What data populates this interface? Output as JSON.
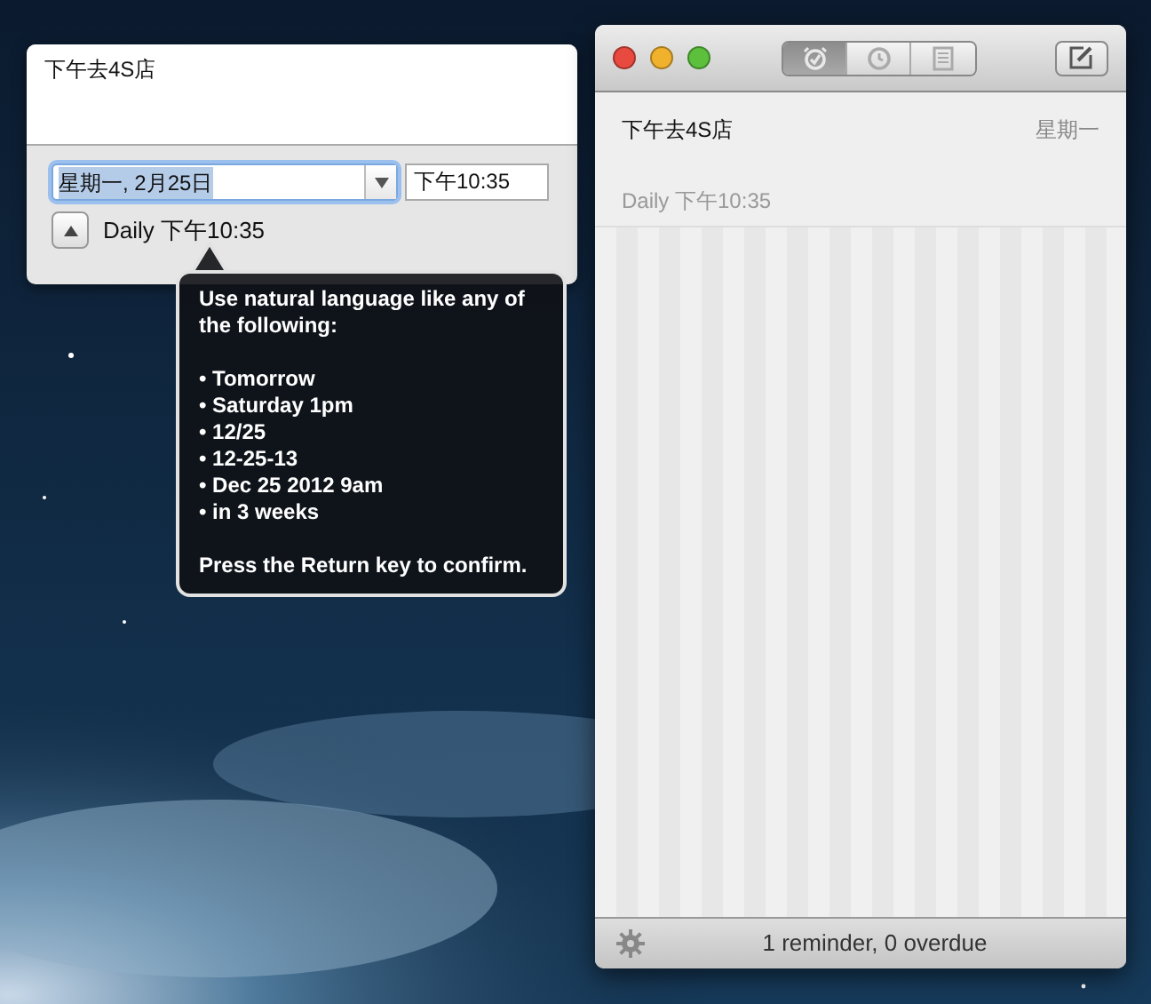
{
  "popover": {
    "note": "下午去4S店",
    "date_field": {
      "value": "星期一, 2月25日",
      "text_selected": true
    },
    "time_field": {
      "value": "下午10:35"
    },
    "repeat_summary": "Daily 下午10:35"
  },
  "tooltip": {
    "intro": "Use natural language like any of the following:",
    "examples": [
      "• Tomorrow",
      "• Saturday 1pm",
      "• 12/25",
      "• 12-25-13",
      "• Dec 25 2012 9am",
      "• in 3 weeks"
    ],
    "footer": "Press the Return key to confirm."
  },
  "window": {
    "view_tabs": [
      {
        "kind": "reminders",
        "selected": true
      },
      {
        "kind": "history",
        "selected": false
      },
      {
        "kind": "notes",
        "selected": false
      }
    ],
    "reminders": [
      {
        "title": "下午去4S店",
        "day": "星期一",
        "repeat": "Daily 下午10:35"
      }
    ],
    "status_bar": "1 reminder, 0 overdue"
  }
}
